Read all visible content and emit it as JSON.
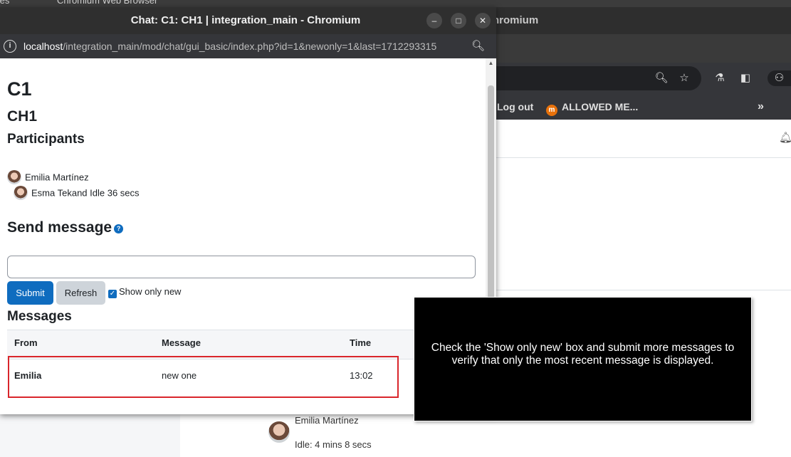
{
  "background_window": {
    "top_strip_left": "tes",
    "top_strip_title": "Chromium Web Browser",
    "title_fragment": "hromium",
    "bookmarks": {
      "logout": "Log out",
      "allowed": "ALLOWED ME...",
      "more": "»"
    },
    "participant": {
      "name": "Emilia Martínez",
      "idle": "Idle: 4 mins 8 secs"
    }
  },
  "popup": {
    "title": "Chat: C1: CH1 | integration_main - Chromium",
    "url_host": "localhost",
    "url_path": "/integration_main/mod/chat/gui_basic/index.php?id=1&newonly=1&last=1712293315",
    "course_name": "C1",
    "chat_name": "CH1",
    "participants_heading": "Participants",
    "participants": [
      {
        "name": "Emilia Martínez"
      },
      {
        "name": "Esma Tekand Idle 36 secs"
      }
    ],
    "send_heading": "Send message",
    "message_value": "",
    "submit_label": "Submit",
    "refresh_label": "Refresh",
    "show_only_new_label": "Show only new",
    "show_only_new_checked": true,
    "messages_heading": "Messages",
    "table": {
      "headers": [
        "From",
        "Message",
        "Time"
      ],
      "rows": [
        {
          "from": "Emilia",
          "message": "new one",
          "time": "13:02"
        }
      ]
    }
  },
  "tooltip": {
    "text": "Check the 'Show only new' box and submit more messages to verify that only the most recent message is displayed."
  },
  "colors": {
    "primary": "#0f6cbf",
    "highlight": "#d9262b",
    "titlebar": "#2f2f2f"
  }
}
